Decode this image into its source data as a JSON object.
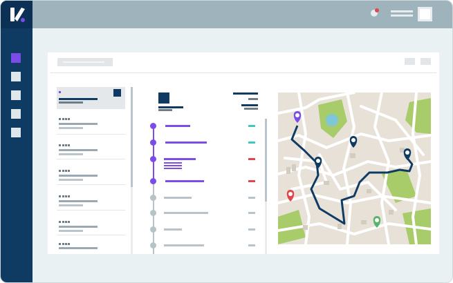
{
  "app": {
    "brand_color": "#7b4ce8",
    "sidebar_color": "#0f3b63",
    "topbar_color": "#9fb3bd",
    "accent_colors": {
      "purple": "#7b4ce8",
      "teal": "#3ec9c2",
      "red": "#e0474c",
      "gray": "#b7c3c9",
      "green": "#56b36a"
    }
  },
  "icons": {
    "logo": "app-logo-check-icon",
    "notification": "bell-icon",
    "user": "user-avatar",
    "nav": [
      "nav-square-active",
      "nav-square",
      "nav-square",
      "nav-square",
      "nav-square"
    ]
  },
  "list": {
    "item_count": 7,
    "selected_index": 0
  },
  "timeline": {
    "steps_completed": 4,
    "steps_total": 9,
    "statuses": [
      "teal",
      "teal",
      "red",
      "red",
      "gray",
      "gray",
      "gray",
      "gray",
      "gray"
    ]
  },
  "map": {
    "pins": [
      {
        "name": "origin-pin",
        "color": "#7b4ce8"
      },
      {
        "name": "stop-pin",
        "color": "#0f3b63"
      },
      {
        "name": "stop-pin",
        "color": "#0f3b63"
      },
      {
        "name": "stop-pin",
        "color": "#0f3b63"
      },
      {
        "name": "alert-pin",
        "color": "#e0474c"
      },
      {
        "name": "destination-pin",
        "color": "#56b36a"
      }
    ]
  }
}
